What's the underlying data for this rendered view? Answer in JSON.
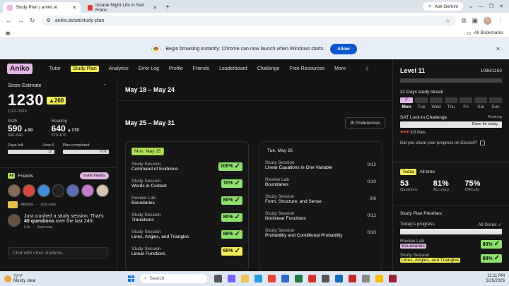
{
  "browser": {
    "tabs": [
      {
        "title": "Study Plan | aniko.ai",
        "active": true,
        "color": "#e7b6e8"
      },
      {
        "title": "Insane Night Life in San Franc",
        "active": false,
        "color": "#e53935"
      }
    ],
    "ask_gemini": "Ask Gemini",
    "url": "aniko.ai/sat/study-plan",
    "profile_initial": "A",
    "all_bookmarks": "All Bookmarks",
    "info_message": "Begin browsing instantly: Chrome can now launch when Windows starts.",
    "allow_label": "Allow"
  },
  "app": {
    "logo": "Aniko",
    "nav": [
      "Tutor",
      "Study Plan",
      "Analytics",
      "Error Log",
      "Profile",
      "Friends",
      "Leaderboard",
      "Challenge",
      "Free Resources",
      "More"
    ],
    "active_nav": "Study Plan"
  },
  "score": {
    "title": "Score Estimate",
    "total": "1230",
    "gain": "▲260",
    "range": "1110–1310",
    "math": {
      "label": "Math",
      "score": "590",
      "gain": "▲90",
      "range": "540–640"
    },
    "reading": {
      "label": "Reading",
      "score": "640",
      "gain": "▲170",
      "range": "570–670"
    },
    "days_left_label": "Days left",
    "days_left_date": "June 6",
    "days_left_value": "12",
    "plan_completed_label": "Plan completed",
    "plan_completed_value": "61%"
  },
  "friends": {
    "title": "Friends",
    "icon_label": "All",
    "invite_label": "Invite friends",
    "feed": [
      {
        "name": "Abishai",
        "time": "Just now"
      }
    ],
    "post": {
      "text_before": "Just crushed a study session. That's ",
      "highlight": "40 questions",
      "text_after": " over the last 24h!",
      "name": "LJx",
      "time": "Just now"
    },
    "chat_placeholder": "Chat with other students..."
  },
  "main": {
    "week1": "May 18 – May 24",
    "week2": "May 25 – May 31",
    "preferences_label": "Preferences",
    "days": [
      {
        "label": "Mon, May 25",
        "today": true,
        "sessions": [
          {
            "type": "Study Session",
            "name": "Command of Evidence",
            "score": "100%",
            "color": "green"
          },
          {
            "type": "Study Session",
            "name": "Words in Context",
            "score": "70%",
            "color": "green"
          },
          {
            "type": "Review Lab",
            "name": "Boundaries",
            "score": "80%",
            "color": "green"
          },
          {
            "type": "Study Session",
            "name": "Transitions",
            "score": "80%",
            "color": "green"
          },
          {
            "type": "Study Session",
            "name": "Lines, Angles, and Triangles",
            "score": "88%",
            "color": "green"
          },
          {
            "type": "Study Session",
            "name": "Linear Functions",
            "score": "60%",
            "color": "yellow"
          }
        ]
      },
      {
        "label": "Tue, May 26",
        "today": false,
        "sessions": [
          {
            "type": "Study Session",
            "name": "Linear Equations in One Variable",
            "count": "0/12"
          },
          {
            "type": "Review Lab",
            "name": "Boundaries",
            "count": "0/10"
          },
          {
            "type": "Study Session",
            "name": "Form, Structure, and Sense",
            "count": "0/6"
          },
          {
            "type": "Study Session",
            "name": "Nonlinear Functions",
            "count": "0/12"
          },
          {
            "type": "Study Session",
            "name": "Probability and Conditional Probability",
            "count": "0/10"
          }
        ]
      }
    ]
  },
  "level": {
    "title": "Level 11",
    "xp": "1086/1150",
    "streak_title": "31 Days study streak",
    "days": [
      "Mon",
      "Tue",
      "Wed",
      "Thu",
      "Fri",
      "Sat",
      "Sun"
    ],
    "current_day": "Mon",
    "challenge_title": "SAT Lock-In Challenge",
    "ranking_label": "Ranking",
    "challenge_status": "Done for today.",
    "lives": "3/3 lives",
    "discord_question": "Did you share your progress on Discord?"
  },
  "stats": {
    "today_tab": "Today",
    "alltime_tab": "All-time",
    "questions": {
      "value": "53",
      "label": "Questions"
    },
    "accuracy": {
      "value": "81%",
      "label": "Accuracy"
    },
    "difficulty": {
      "value": "75%",
      "label": "Difficulty"
    }
  },
  "priorities": {
    "title": "Study Plan Priorities:",
    "progress_label": "Today's progress",
    "progress_status": "All Done!",
    "items": [
      {
        "type": "Review Lab",
        "name": "Boundaries",
        "score": "80%",
        "color": "pink"
      },
      {
        "type": "Study Session",
        "name": "Lines, Angles, and Triangles",
        "score": "88%",
        "color": "yellow"
      }
    ]
  },
  "taskbar": {
    "temp": "72°F",
    "weather": "Mostly clear",
    "search_placeholder": "Search",
    "time": "11:11 PM",
    "date": "5/25/2026"
  }
}
